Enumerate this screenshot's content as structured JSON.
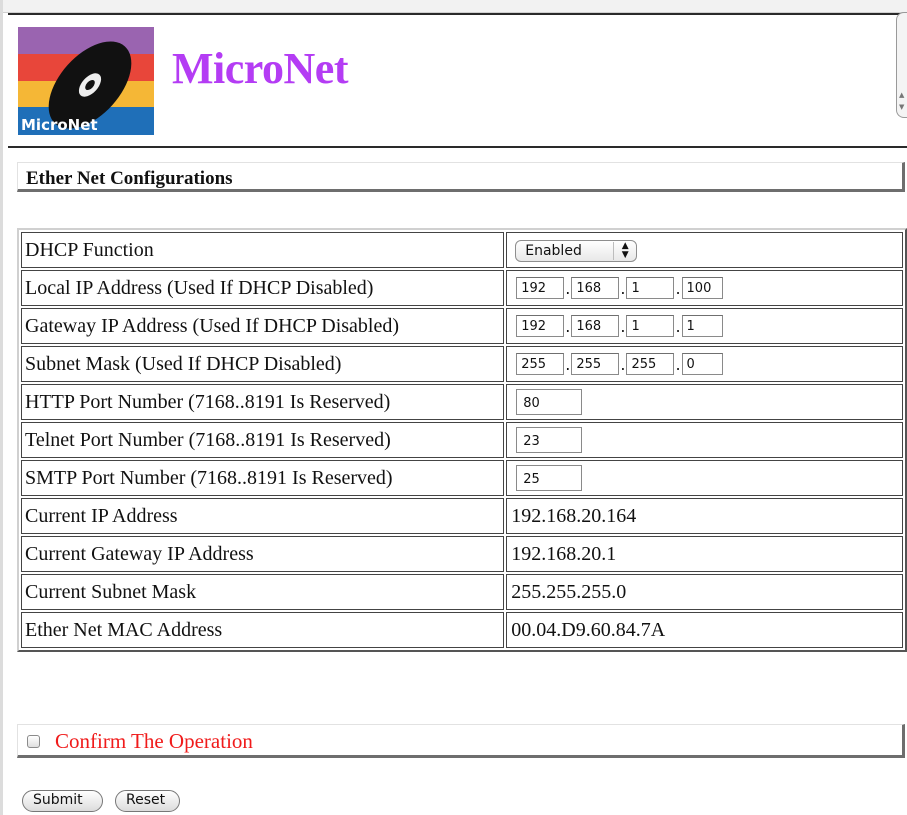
{
  "brand": {
    "title": "MicroNet",
    "logo_text": "MicroNet"
  },
  "section": {
    "title": "Ether Net Configurations"
  },
  "rows": [
    {
      "label": "DHCP Function"
    },
    {
      "label": "Local IP Address (Used If DHCP Disabled)"
    },
    {
      "label": "Gateway IP Address (Used If DHCP Disabled)"
    },
    {
      "label": "Subnet Mask (Used If DHCP Disabled)"
    },
    {
      "label": "HTTP Port Number (7168..8191 Is Reserved)"
    },
    {
      "label": "Telnet Port Number (7168..8191 Is Reserved)"
    },
    {
      "label": "SMTP Port Number (7168..8191 Is Reserved)"
    },
    {
      "label": "Current IP Address"
    },
    {
      "label": "Current Gateway IP Address"
    },
    {
      "label": "Current Subnet Mask"
    },
    {
      "label": "Ether Net MAC Address"
    }
  ],
  "dhcp": {
    "selected": "Enabled"
  },
  "local_ip": [
    "192",
    "168",
    "1",
    "100"
  ],
  "gateway_ip": [
    "192",
    "168",
    "1",
    "1"
  ],
  "subnet_mask": [
    "255",
    "255",
    "255",
    "0"
  ],
  "ports": {
    "http": "80",
    "telnet": "23",
    "smtp": "25"
  },
  "current": {
    "ip": "192.168.20.164",
    "gateway": "192.168.20.1",
    "subnet": "255.255.255.0",
    "mac": "00.04.D9.60.84.7A"
  },
  "confirm": {
    "label": "Confirm The Operation",
    "checked": false
  },
  "buttons": {
    "submit": "Submit",
    "reset": "Reset"
  },
  "colors": {
    "brand": "#b43cf4",
    "confirm_text": "#f01b1b"
  }
}
